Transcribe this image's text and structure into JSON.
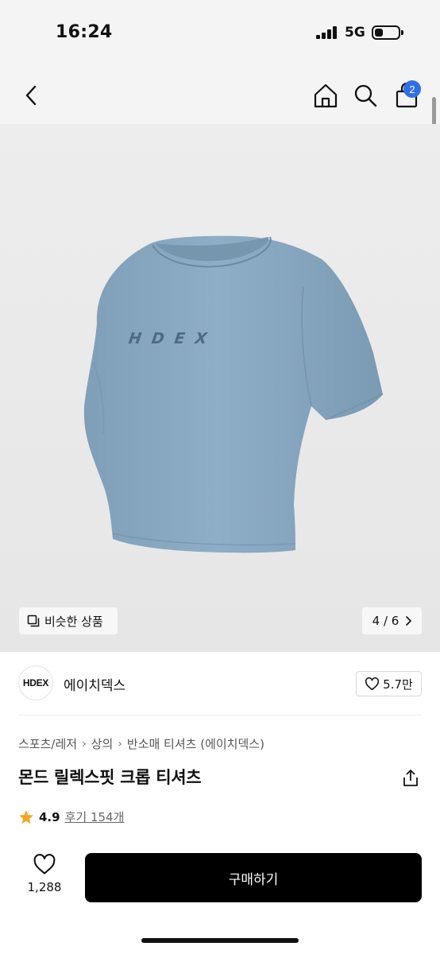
{
  "status": {
    "time": "16:24",
    "network": "5G",
    "icons": [
      "signal-icon",
      "battery-icon"
    ]
  },
  "nav": {
    "icons": [
      "back-arrow-icon",
      "home-icon",
      "search-icon",
      "shopping-bag-icon"
    ],
    "cart_count": "2",
    "badge_color": "#2f6fe6"
  },
  "gallery": {
    "shirt_logo": "HDEX",
    "shirt_color": "#8aa9c2",
    "similar_label": "비슷한 상품",
    "page_indicator": "4 / 6"
  },
  "brand": {
    "logo_text": "HDEX",
    "name": "에이치덱스",
    "likes": "5.7만"
  },
  "product": {
    "breadcrumb": [
      "스포츠/레저",
      "상의",
      "반소매 티셔츠 (에이치덱스)"
    ],
    "title": "몬드 릴렉스핏 크롭 티셔츠",
    "rating": "4.9",
    "reviews": "후기 154개",
    "star_color": "#f5a623"
  },
  "purchase": {
    "wish_count": "1,288",
    "buy_label": "구매하기"
  }
}
